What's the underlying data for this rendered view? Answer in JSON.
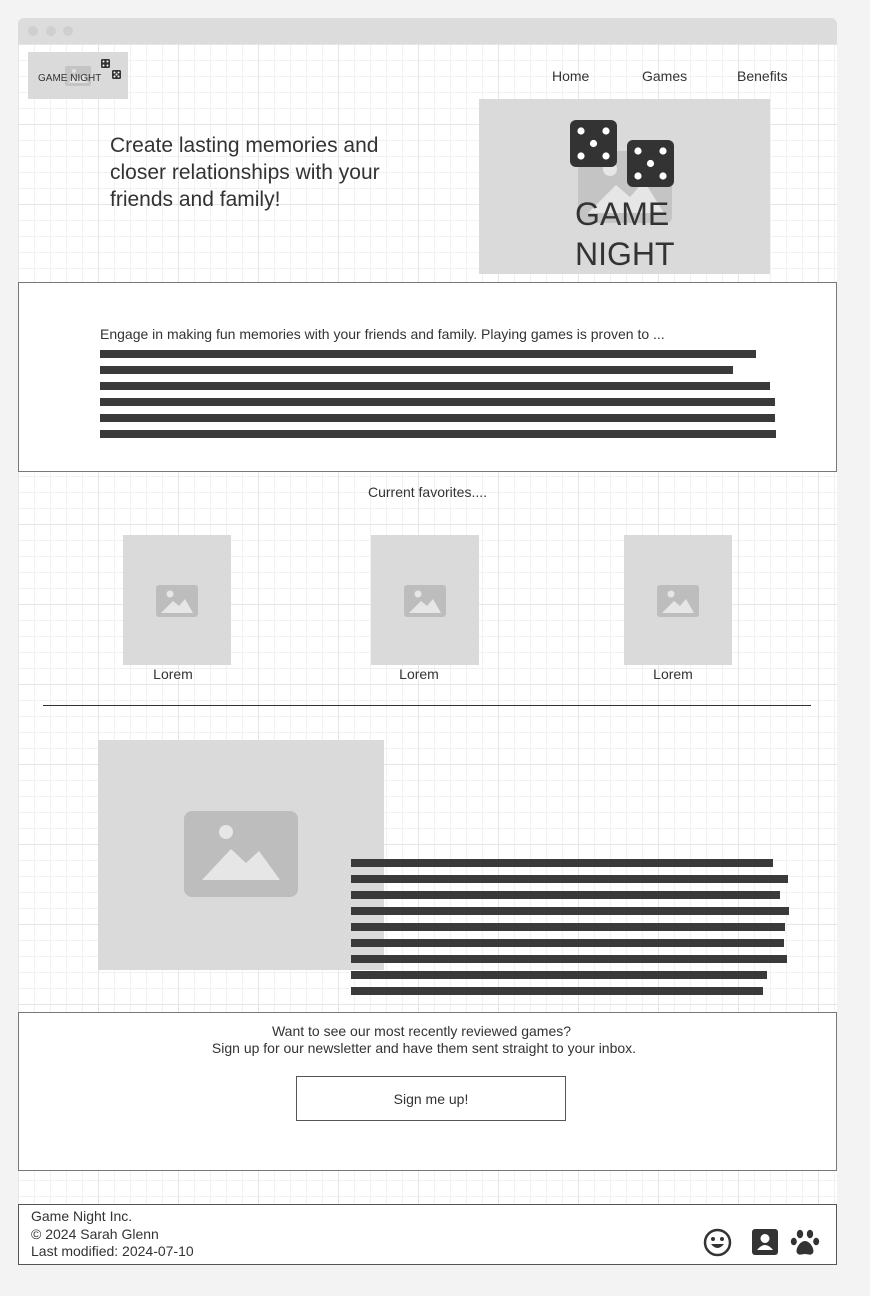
{
  "logo": {
    "text": "GAME NIGHT"
  },
  "nav": {
    "items": [
      "Home",
      "Games",
      "Benefits"
    ]
  },
  "hero": {
    "headline": "Create lasting memories and closer relationships with your friends and family!",
    "banner_line1": "GAME",
    "banner_line2": "NIGHT"
  },
  "intro": {
    "text": "Engage in making fun memories with your friends and family. Playing games is proven to ..."
  },
  "favorites": {
    "heading": "Current favorites....",
    "items": [
      {
        "label": "Lorem"
      },
      {
        "label": "Lorem"
      },
      {
        "label": "Lorem"
      }
    ]
  },
  "newsletter": {
    "line1": "Want to see our most recently reviewed games?",
    "line2": "Sign up for our newsletter and have them sent straight to your inbox.",
    "button_label": "Sign me up!"
  },
  "footer": {
    "company": "Game Night Inc.",
    "copyright": "© 2024 Sarah Glenn",
    "modified": "Last modified: 2024-07-10",
    "icons": [
      "smiley-icon",
      "contact-card-icon",
      "paw-icon"
    ]
  },
  "colors": {
    "placeholder": "#dadada",
    "text_bar": "#3a3a3a",
    "icon": "#333333"
  }
}
